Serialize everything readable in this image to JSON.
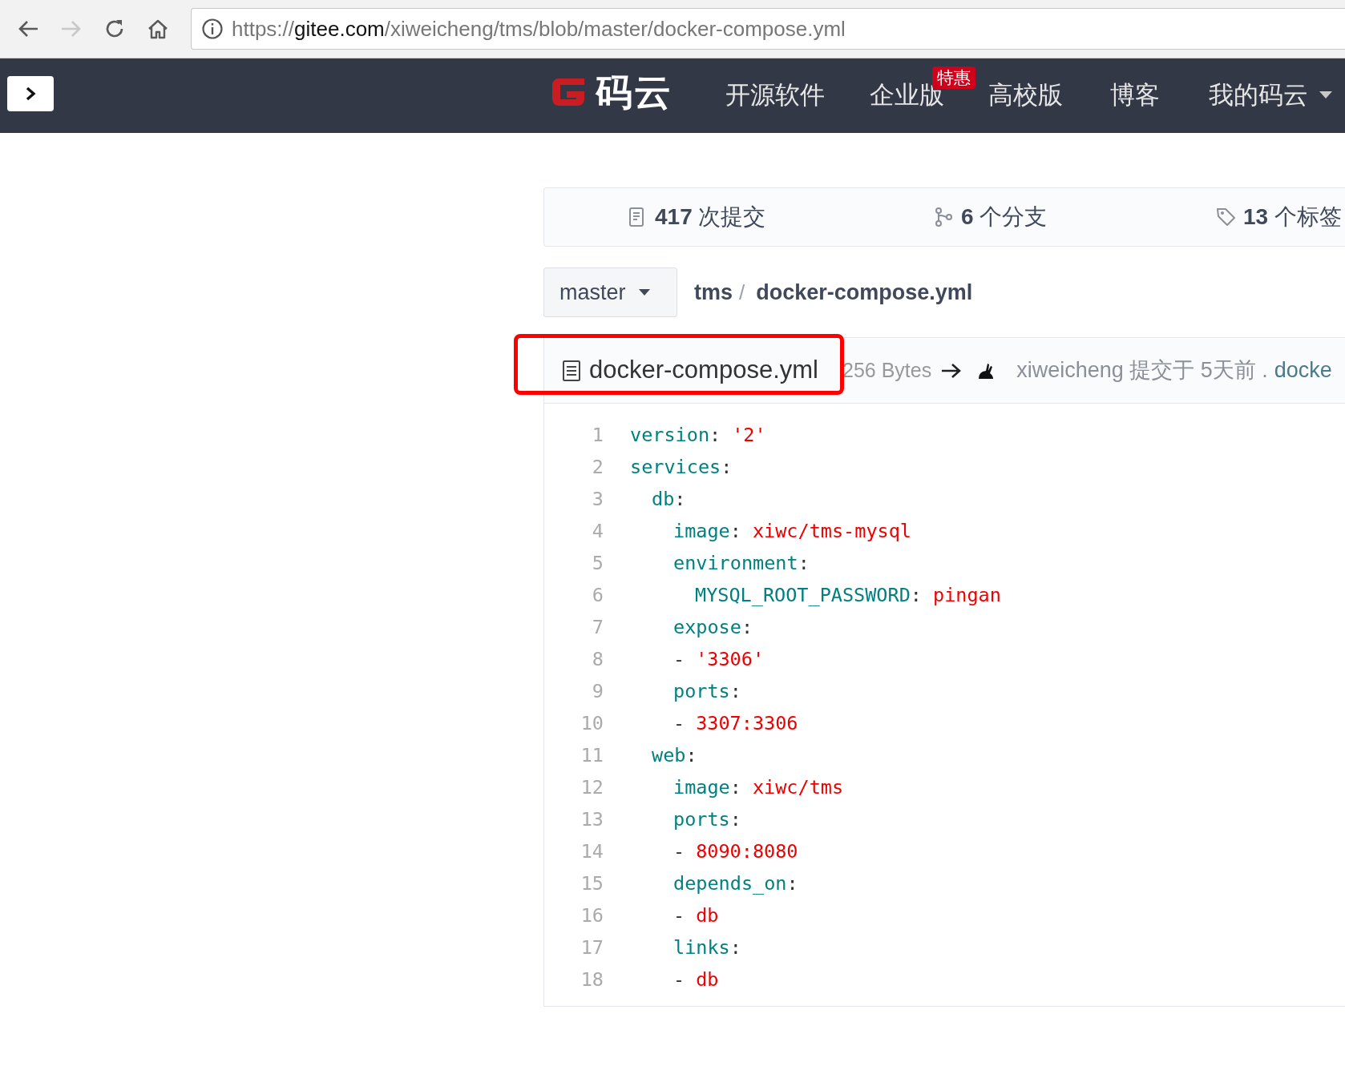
{
  "browser": {
    "url_scheme": "https://",
    "url_host": "gitee.com",
    "url_path": "/xiweicheng/tms/blob/master/docker-compose.yml",
    "back_disabled": false,
    "forward_disabled": true
  },
  "navbar": {
    "logo_text": "码云",
    "items": [
      {
        "label": "开源软件"
      },
      {
        "label": "企业版",
        "badge": "特惠"
      },
      {
        "label": "高校版"
      },
      {
        "label": "博客"
      },
      {
        "label": "我的码云",
        "dropdown": true
      }
    ]
  },
  "stats": [
    {
      "kind": "commits",
      "count": "417",
      "label": "次提交"
    },
    {
      "kind": "branches",
      "count": "6",
      "label": "个分支"
    },
    {
      "kind": "tags",
      "count": "13",
      "label": "个标签"
    }
  ],
  "branch": "master",
  "breadcrumb": {
    "repo": "tms",
    "separator": "/",
    "file": "docker-compose.yml"
  },
  "file_header": {
    "name": "docker-compose.yml",
    "size": "256 Bytes",
    "author": "xiweicheng",
    "action": "提交于",
    "time": "5天前",
    "separator": ".",
    "commit_link": "docke",
    "highlighted": true
  },
  "code": [
    {
      "number": "1",
      "tokens": [
        {
          "kind": "key",
          "text": "version"
        },
        {
          "kind": "punct",
          "text": ":"
        },
        {
          "kind": "string",
          "text": "'2'"
        }
      ]
    },
    {
      "number": "2",
      "tokens": [
        {
          "kind": "key",
          "text": "services"
        },
        {
          "kind": "punct",
          "text": ":"
        }
      ],
      "children": [
        {
          "number": "3",
          "tokens": [
            {
              "kind": "key",
              "text": "db"
            },
            {
              "kind": "punct",
              "text": ":"
            }
          ],
          "children": [
            {
              "number": "4",
              "tokens": [
                {
                  "kind": "key",
                  "text": "image"
                },
                {
                  "kind": "punct",
                  "text": ":"
                },
                {
                  "kind": "string",
                  "text": "xiwc/tms-mysql"
                }
              ]
            },
            {
              "number": "5",
              "tokens": [
                {
                  "kind": "key",
                  "text": "environment"
                },
                {
                  "kind": "punct",
                  "text": ":"
                }
              ],
              "children": [
                {
                  "number": "6",
                  "tokens": [
                    {
                      "kind": "key",
                      "text": "MYSQL_ROOT_PASSWORD"
                    },
                    {
                      "kind": "punct",
                      "text": ":"
                    },
                    {
                      "kind": "string",
                      "text": "pingan"
                    }
                  ]
                }
              ]
            },
            {
              "number": "7",
              "tokens": [
                {
                  "kind": "key",
                  "text": "expose"
                },
                {
                  "kind": "punct",
                  "text": ":"
                }
              ]
            },
            {
              "number": "8",
              "tokens": [
                {
                  "kind": "punct",
                  "text": "-"
                },
                {
                  "kind": "string",
                  "text": "'3306'"
                }
              ]
            },
            {
              "number": "9",
              "tokens": [
                {
                  "kind": "key",
                  "text": "ports"
                },
                {
                  "kind": "punct",
                  "text": ":"
                }
              ]
            },
            {
              "number": "10",
              "tokens": [
                {
                  "kind": "punct",
                  "text": "-"
                },
                {
                  "kind": "string",
                  "text": "3307:3306"
                }
              ]
            }
          ]
        },
        {
          "number": "11",
          "tokens": [
            {
              "kind": "key",
              "text": "web"
            },
            {
              "kind": "punct",
              "text": ":"
            }
          ],
          "children": [
            {
              "number": "12",
              "tokens": [
                {
                  "kind": "key",
                  "text": "image"
                },
                {
                  "kind": "punct",
                  "text": ":"
                },
                {
                  "kind": "string",
                  "text": "xiwc/tms"
                }
              ]
            },
            {
              "number": "13",
              "tokens": [
                {
                  "kind": "key",
                  "text": "ports"
                },
                {
                  "kind": "punct",
                  "text": ":"
                }
              ]
            },
            {
              "number": "14",
              "tokens": [
                {
                  "kind": "punct",
                  "text": "-"
                },
                {
                  "kind": "string",
                  "text": "8090:8080"
                }
              ]
            },
            {
              "number": "15",
              "tokens": [
                {
                  "kind": "key",
                  "text": "depends_on"
                },
                {
                  "kind": "punct",
                  "text": ":"
                }
              ]
            },
            {
              "number": "16",
              "tokens": [
                {
                  "kind": "punct",
                  "text": "-"
                },
                {
                  "kind": "string",
                  "text": "db"
                }
              ]
            },
            {
              "number": "17",
              "tokens": [
                {
                  "kind": "key",
                  "text": "links"
                },
                {
                  "kind": "punct",
                  "text": ":"
                }
              ]
            },
            {
              "number": "18",
              "tokens": [
                {
                  "kind": "punct",
                  "text": "-"
                },
                {
                  "kind": "string",
                  "text": "db"
                }
              ]
            }
          ]
        }
      ]
    }
  ]
}
